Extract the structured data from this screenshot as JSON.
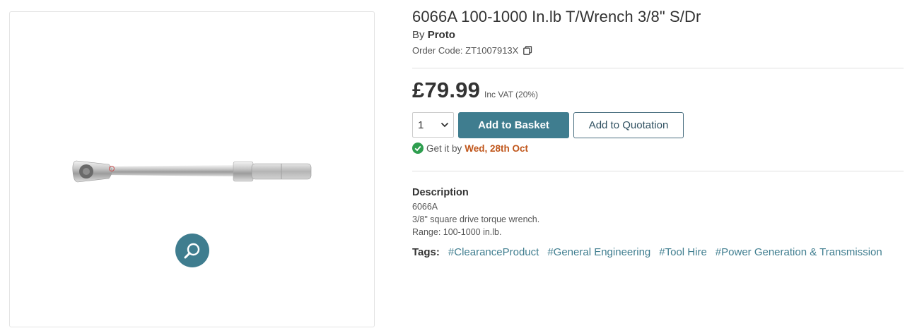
{
  "product": {
    "title": "6066A 100-1000 In.lb T/Wrench 3/8\" S/Dr",
    "by_prefix": "By",
    "brand": "Proto",
    "order_code_label": "Order Code:",
    "order_code": "ZT1007913X"
  },
  "pricing": {
    "price": "£79.99",
    "vat_note": "Inc VAT (20%)"
  },
  "purchase": {
    "quantity": "1",
    "add_to_basket_label": "Add to Basket",
    "add_to_quotation_label": "Add to Quotation",
    "delivery_prefix": "Get it by",
    "delivery_date": "Wed, 28th Oct"
  },
  "description": {
    "heading": "Description",
    "lines": [
      "6066A",
      "3/8\" square drive torque wrench.",
      "Range: 100-1000 in.lb."
    ]
  },
  "tags": {
    "label": "Tags:",
    "items": [
      "#ClearanceProduct",
      "#General Engineering",
      "#Tool Hire",
      "#Power Generation & Transmission"
    ]
  },
  "icons": {
    "zoom": "magnifier-icon",
    "copy": "copy-icon",
    "delivery": "check-circle-icon",
    "select": "chevron-down-icon"
  },
  "colors": {
    "accent": "#3f7d8f",
    "delivery_date": "#c0561b",
    "check": "#2e9e4f"
  }
}
